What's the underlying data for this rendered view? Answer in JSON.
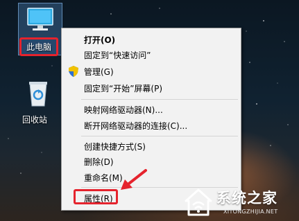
{
  "desktop": {
    "this_pc_label": "此电脑",
    "recycle_bin_label": "回收站"
  },
  "context_menu": {
    "items": [
      {
        "label": "打开(O)"
      },
      {
        "label": "固定到“快速访问”"
      },
      {
        "label": "管理(G)"
      },
      {
        "label": "固定到“开始”屏幕(P)"
      },
      {
        "label": "映射网络驱动器(N)..."
      },
      {
        "label": "断开网络驱动器的连接(C)..."
      },
      {
        "label": "创建快捷方式(S)"
      },
      {
        "label": "删除(D)"
      },
      {
        "label": "重命名(M)"
      },
      {
        "label": "属性(R)"
      }
    ]
  },
  "watermark": {
    "brand": "系统之家",
    "url": "XITONGZHIJIA.NET"
  },
  "colors": {
    "highlight_red": "#e5232d",
    "menu_bg": "#f2f2f2"
  }
}
